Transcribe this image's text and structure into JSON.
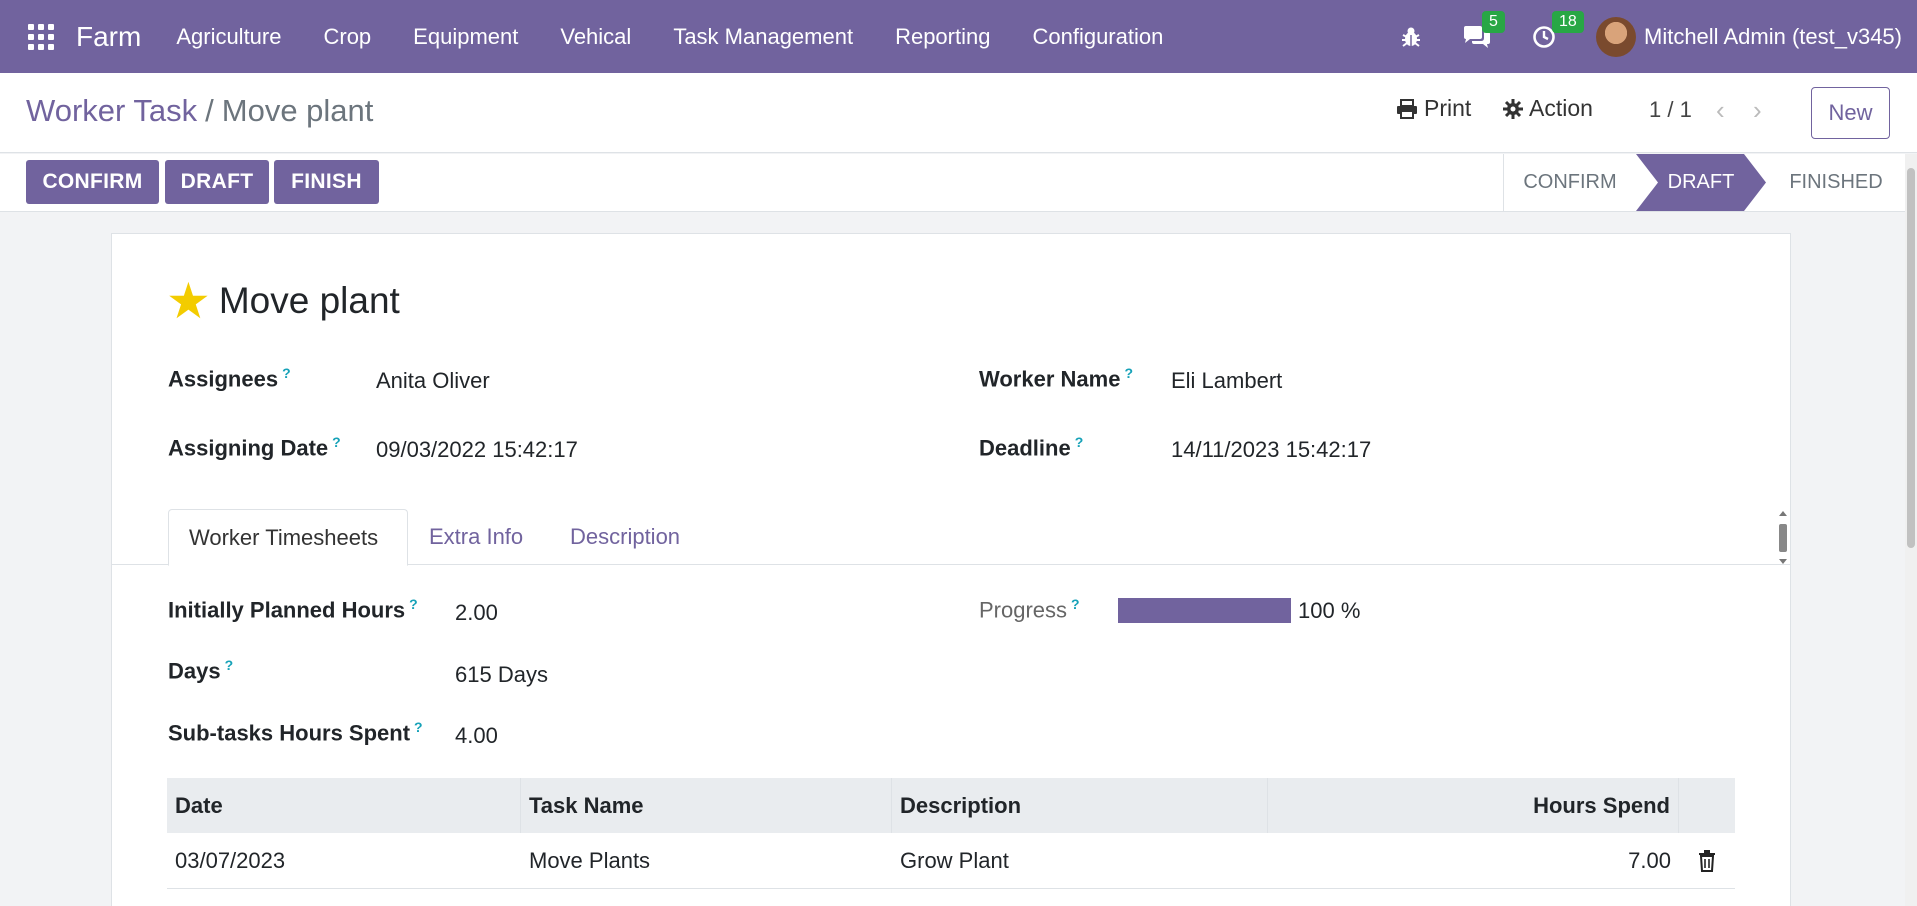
{
  "navbar": {
    "brand": "Farm",
    "menu": [
      "Agriculture",
      "Crop",
      "Equipment",
      "Vehical",
      "Task Management",
      "Reporting",
      "Configuration"
    ],
    "messages_count": "5",
    "activities_count": "18",
    "user": "Mitchell Admin (test_v345)",
    "accent_color": "#71639e"
  },
  "control_panel": {
    "breadcrumb_parent": "Worker Task",
    "breadcrumb_separator": "/",
    "breadcrumb_current": "Move plant",
    "print_label": "Print",
    "action_label": "Action",
    "pager": "1 / 1",
    "new_label": "New"
  },
  "statusbar": {
    "buttons": [
      "CONFIRM",
      "DRAFT",
      "FINISH"
    ],
    "stages": [
      "CONFIRM",
      "DRAFT",
      "FINISHED"
    ],
    "active_stage": "DRAFT"
  },
  "form": {
    "title": "Move plant",
    "starred": true,
    "assignees_label": "Assignees",
    "assignees_value": "Anita Oliver",
    "worker_name_label": "Worker Name",
    "worker_name_value": "Eli Lambert",
    "assigning_date_label": "Assigning Date",
    "assigning_date_value": "09/03/2022 15:42:17",
    "deadline_label": "Deadline",
    "deadline_value": "14/11/2023 15:42:17",
    "help_mark": "?"
  },
  "tabs": [
    "Worker Timesheets",
    "Extra Info",
    "Description"
  ],
  "timesheet": {
    "planned_hours_label": "Initially Planned Hours",
    "planned_hours_value": "2.00",
    "days_label": "Days",
    "days_value": "615 Days",
    "subtask_hours_label": "Sub-tasks Hours Spent",
    "subtask_hours_value": "4.00",
    "progress_label": "Progress",
    "progress_text": "100 %",
    "progress_percent": 100
  },
  "table": {
    "headers": [
      "Date",
      "Task Name",
      "Description",
      "Hours Spend"
    ],
    "rows": [
      {
        "date": "03/07/2023",
        "task_name": "Move Plants",
        "description": "Grow Plant",
        "hours": "7.00"
      }
    ]
  }
}
